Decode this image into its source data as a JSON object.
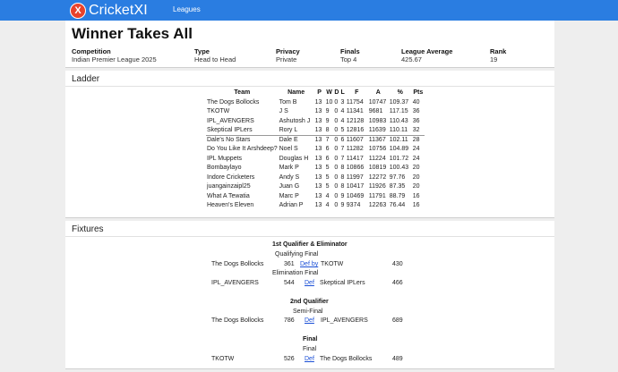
{
  "nav": {
    "brand": "CricketXI",
    "logo_letter": "X",
    "link_leagues": "Leagues",
    "bar_color": "#2a7de1"
  },
  "league": {
    "title": "Winner Takes All",
    "meta": [
      {
        "label": "Competition",
        "value": "Indian Premier League 2025"
      },
      {
        "label": "Type",
        "value": "Head to Head"
      },
      {
        "label": "Privacy",
        "value": "Private"
      },
      {
        "label": "Finals",
        "value": "Top 4"
      },
      {
        "label": "League Average",
        "value": "425.67"
      },
      {
        "label": "Rank",
        "value": "19"
      }
    ]
  },
  "ladder": {
    "heading": "Ladder",
    "columns": [
      "Team",
      "Name",
      "P",
      "W",
      "D",
      "L",
      "F",
      "A",
      "%",
      "Pts"
    ],
    "rows": [
      [
        "The Dogs Bollocks",
        "Tom B",
        "13",
        "10",
        "0",
        "3",
        "11754",
        "10747",
        "109.37",
        "40"
      ],
      [
        "TKOTW",
        "J S",
        "13",
        "9",
        "0",
        "4",
        "11341",
        "9681",
        "117.15",
        "36"
      ],
      [
        "IPL_AVENGERS",
        "Ashutosh J",
        "13",
        "9",
        "0",
        "4",
        "12128",
        "10983",
        "110.43",
        "36"
      ],
      [
        "Skeptical IPLers",
        "Rory L",
        "13",
        "8",
        "0",
        "5",
        "12816",
        "11639",
        "110.11",
        "32"
      ],
      [
        "Dale's No Stars",
        "Dale E",
        "13",
        "7",
        "0",
        "6",
        "11607",
        "11367",
        "102.11",
        "28"
      ],
      [
        "Do You Like It Arshdeep?",
        "Noel S",
        "13",
        "6",
        "0",
        "7",
        "11282",
        "10756",
        "104.89",
        "24"
      ],
      [
        "IPL Muppets",
        "Douglas H",
        "13",
        "6",
        "0",
        "7",
        "11417",
        "11224",
        "101.72",
        "24"
      ],
      [
        "Bombaylayo",
        "Mark P",
        "13",
        "5",
        "0",
        "8",
        "10866",
        "10819",
        "100.43",
        "20"
      ],
      [
        "Indore Cricketers",
        "Andy S",
        "13",
        "5",
        "0",
        "8",
        "11997",
        "12272",
        "97.76",
        "20"
      ],
      [
        "juangainzaipl25",
        "Juan G",
        "13",
        "5",
        "0",
        "8",
        "10417",
        "11926",
        "87.35",
        "20"
      ],
      [
        "What A Tewatia",
        "Marc P",
        "13",
        "4",
        "0",
        "9",
        "10469",
        "11791",
        "88.79",
        "16"
      ],
      [
        "Heaven's Eleven",
        "Adrian P",
        "13",
        "4",
        "0",
        "9",
        "9374",
        "12263",
        "76.44",
        "16"
      ]
    ]
  },
  "fixtures": {
    "heading": "Fixtures",
    "rounds": [
      {
        "title": "1st Qualifier & Eliminator",
        "games": [
          {
            "label": "Qualifying Final",
            "home": "The Dogs Bollocks",
            "home_score": "361",
            "link": "Def by",
            "away": "TKOTW",
            "away_score": "430"
          },
          {
            "label": "Elimination Final",
            "home": "IPL_AVENGERS",
            "home_score": "544",
            "link": "Def",
            "away": "Skeptical IPLers",
            "away_score": "466"
          }
        ]
      },
      {
        "title": "2nd Qualifier",
        "games": [
          {
            "label": "Semi-Final",
            "home": "The Dogs Bollocks",
            "home_score": "786",
            "link": "Def",
            "away": "IPL_AVENGERS",
            "away_score": "689"
          }
        ]
      },
      {
        "title": "Final",
        "games": [
          {
            "label": "Final",
            "home": "TKOTW",
            "home_score": "526",
            "link": "Def",
            "away": "The Dogs Bollocks",
            "away_score": "489"
          }
        ]
      }
    ]
  }
}
